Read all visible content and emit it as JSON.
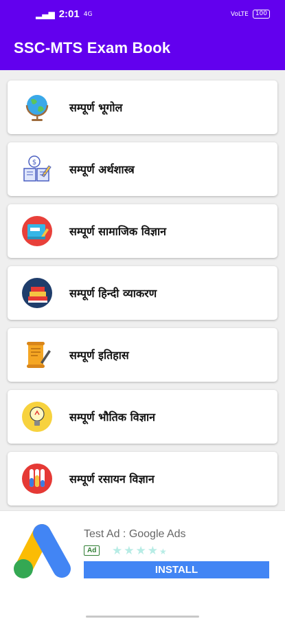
{
  "status_bar": {
    "time": "2:01",
    "network_left": "4G",
    "network_right": "VoLTE",
    "battery": "100"
  },
  "app_bar": {
    "title": "SSC-MTS Exam Book"
  },
  "items": [
    {
      "label": "सम्पूर्ण भूगोल",
      "icon": "globe-icon"
    },
    {
      "label": "सम्पूर्ण अर्थशास्त्र",
      "icon": "economics-book-icon"
    },
    {
      "label": "सम्पूर्ण सामाजिक विज्ञान",
      "icon": "notebook-icon"
    },
    {
      "label": " सम्पूर्ण हिन्दी व्याकरण",
      "icon": "books-icon"
    },
    {
      "label": "सम्पूर्ण इतिहास",
      "icon": "scroll-quill-icon"
    },
    {
      "label": "सम्पूर्ण भौतिक विज्ञान",
      "icon": "lightbulb-icon"
    },
    {
      "label": "सम्पूर्ण रसायन विज्ञान",
      "icon": "test-tubes-icon"
    }
  ],
  "ad": {
    "title": "Test Ad : Google Ads",
    "badge": "Ad",
    "rating_stars": 4.5,
    "install_label": "INSTALL",
    "logo_icon": "google-ads-logo-icon"
  },
  "colors": {
    "primary": "#6200ee",
    "install_button": "#4285f4",
    "ad_badge": "#2e7d32"
  }
}
